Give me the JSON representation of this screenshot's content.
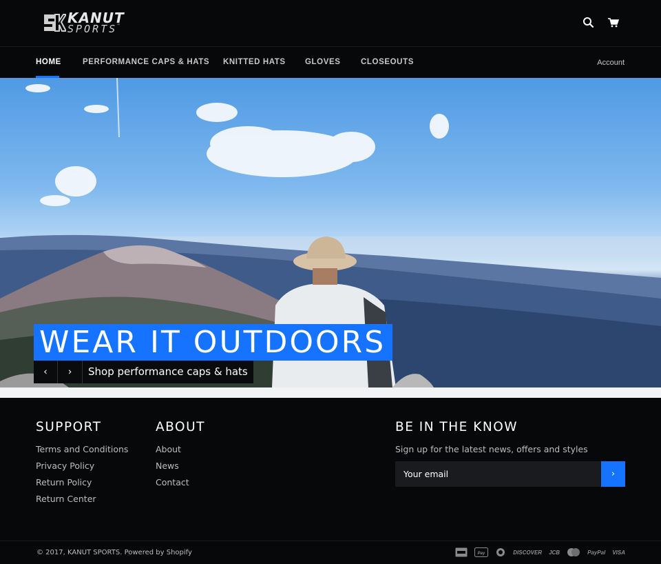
{
  "header": {
    "logo": {
      "line1": "KANUT",
      "line2": "SPORTS",
      "tm": "™"
    },
    "icons": {
      "search": "search-icon",
      "cart": "cart-icon"
    }
  },
  "nav": {
    "items": [
      {
        "label": "HOME",
        "active": true
      },
      {
        "label": "PERFORMANCE CAPS & HATS",
        "active": false
      },
      {
        "label": "KNITTED HATS",
        "active": false
      },
      {
        "label": "GLOVES",
        "active": false
      },
      {
        "label": "CLOSEOUTS",
        "active": false
      }
    ],
    "account": "Account"
  },
  "hero": {
    "headline": "WEAR IT OUTDOORS",
    "cta": "Shop performance caps & hats",
    "prev_icon": "chevron-left-icon",
    "next_icon": "chevron-right-icon"
  },
  "footer": {
    "support": {
      "heading": "SUPPORT",
      "links": [
        "Terms and Conditions",
        "Privacy Policy",
        "Return Policy",
        "Return Center"
      ]
    },
    "about": {
      "heading": "ABOUT",
      "links": [
        "About",
        "News",
        "Contact"
      ]
    },
    "newsletter": {
      "heading": "BE IN THE KNOW",
      "text": "Sign up for the latest news, offers and styles",
      "placeholder": "Your email",
      "submit_icon": "chevron-right-icon"
    },
    "copyright": "© 2017, KANUT SPORTS. Powered by Shopify",
    "payments": [
      "amex",
      "apple pay",
      "diners",
      "DISCOVER",
      "JCB",
      "master",
      "PayPal",
      "VISA"
    ]
  },
  "colors": {
    "accent": "#1673ff",
    "background": "#07080a",
    "strip": "#f2f3f5"
  }
}
